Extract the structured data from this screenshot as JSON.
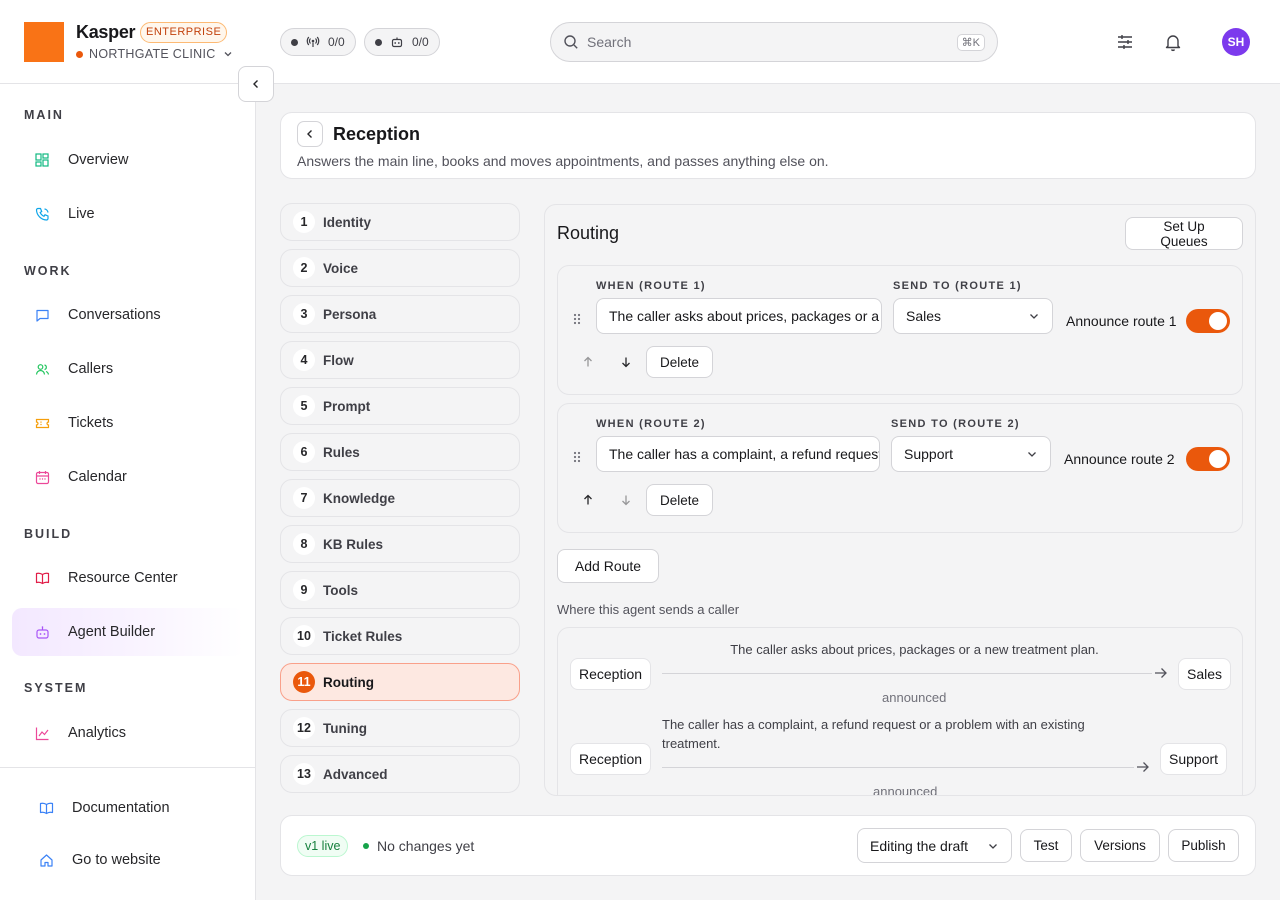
{
  "brand": {
    "name": "Kasper",
    "plan": "ENTERPRISE",
    "org": "NORTHGATE CLINIC"
  },
  "topbar": {
    "pill_calls": "0/0",
    "pill_agents": "0/0",
    "search_placeholder": "Search",
    "search_shortcut": "⌘K",
    "avatar_initials": "SH"
  },
  "sidebar": {
    "sections": {
      "main": "MAIN",
      "work": "WORK",
      "build": "BUILD",
      "system": "SYSTEM"
    },
    "items": {
      "overview": "Overview",
      "live": "Live",
      "conversations": "Conversations",
      "callers": "Callers",
      "tickets": "Tickets",
      "calendar": "Calendar",
      "resource_center": "Resource Center",
      "agent_builder": "Agent Builder",
      "analytics": "Analytics",
      "documentation": "Documentation",
      "go_to_website": "Go to website"
    },
    "active_item": "Agent Builder"
  },
  "header": {
    "title": "Reception",
    "subtitle": "Answers the main line, books and moves appointments, and passes anything else on."
  },
  "steps": [
    {
      "num": "1",
      "label": "Identity"
    },
    {
      "num": "2",
      "label": "Voice"
    },
    {
      "num": "3",
      "label": "Persona"
    },
    {
      "num": "4",
      "label": "Flow"
    },
    {
      "num": "5",
      "label": "Prompt"
    },
    {
      "num": "6",
      "label": "Rules"
    },
    {
      "num": "7",
      "label": "Knowledge"
    },
    {
      "num": "8",
      "label": "KB Rules"
    },
    {
      "num": "9",
      "label": "Tools"
    },
    {
      "num": "10",
      "label": "Ticket Rules"
    },
    {
      "num": "11",
      "label": "Routing"
    },
    {
      "num": "12",
      "label": "Tuning"
    },
    {
      "num": "13",
      "label": "Advanced"
    }
  ],
  "active_step": "11",
  "routing": {
    "title": "Routing",
    "setup_queues_label": "Set Up Queues",
    "routes": [
      {
        "when_label": "WHEN (ROUTE 1)",
        "send_label": "SEND TO (ROUTE 1)",
        "when_value": "The caller asks about prices, packages or a new treatment plan.",
        "send_value": "Sales",
        "announce_label": "Announce route 1",
        "announce_on": true,
        "delete_label": "Delete"
      },
      {
        "when_label": "WHEN (ROUTE 2)",
        "send_label": "SEND TO (ROUTE 2)",
        "when_value": "The caller has a complaint, a refund request or a problem with an existing treatment.",
        "send_value": "Support",
        "announce_label": "Announce route 2",
        "announce_on": true,
        "delete_label": "Delete"
      }
    ],
    "add_route_label": "Add Route",
    "map_caption": "Where this agent sends a caller",
    "map": [
      {
        "from": "Reception",
        "condition": "The caller asks about prices, packages or a new treatment plan.",
        "to": "Sales",
        "note": "announced"
      },
      {
        "from": "Reception",
        "condition": "The caller has a complaint, a refund request or a problem with an existing treatment.",
        "to": "Support",
        "note": "announced"
      }
    ]
  },
  "footer": {
    "version_badge": "v1 live",
    "status": "No changes yet",
    "mode_select": "Editing the draft",
    "test_label": "Test",
    "versions_label": "Versions",
    "publish_label": "Publish"
  },
  "colors": {
    "accent": "#ea580c",
    "brand_square": "#f97316",
    "active_nav": "#f3e8ff",
    "avatar": "#7c3aed",
    "live_green": "#16a34a"
  }
}
